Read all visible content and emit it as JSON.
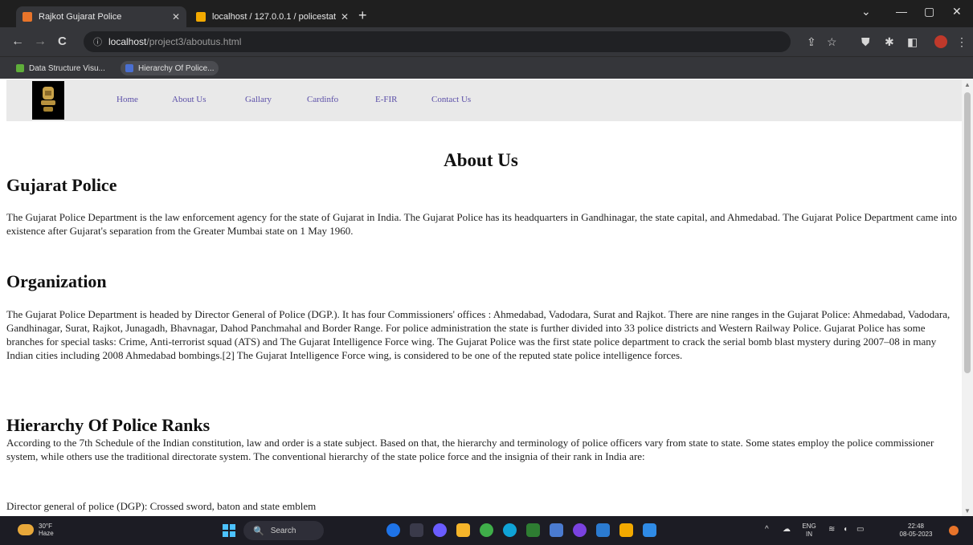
{
  "browser": {
    "tabs": [
      {
        "title": "Rajkot Gujarat Police",
        "active": true,
        "favicon_color": "#e8742a"
      },
      {
        "title": "localhost / 127.0.0.1 / policestat",
        "active": false,
        "favicon_color": "#f2a900"
      }
    ],
    "new_tab_glyph": "+",
    "window_controls": {
      "tab_list": "⌄",
      "minimize": "—",
      "maximize": "▢",
      "close": "✕"
    },
    "nav": {
      "back": "←",
      "forward": "→",
      "reload": "C"
    },
    "address": {
      "host": "localhost",
      "path": "/project3/aboutus.html"
    },
    "bookmarks": [
      {
        "label": "Data Structure Visu...",
        "icon_color": "#5fae3a"
      },
      {
        "label": "Hierarchy Of Police...",
        "icon_color": "#4a6fd1"
      }
    ]
  },
  "site": {
    "nav_links": [
      "Home",
      "About Us",
      "Gallary",
      "Cardinfo",
      "E-FIR",
      "Contact Us"
    ],
    "page_title": "About Us",
    "sections": [
      {
        "heading": "Gujarat Police",
        "paragraphs": [
          "The Gujarat Police Department is the law enforcement agency for the state of Gujarat in India. The Gujarat Police has its headquarters in Gandhinagar, the state capital, and Ahmedabad. The Gujarat Police Department came into existence after Gujarat's separation from the Greater Mumbai state on 1 May 1960."
        ]
      },
      {
        "heading": "Organization",
        "paragraphs": [
          "The Gujarat Police Department is headed by Director General of Police (DGP.). It has four Commissioners' offices : Ahmedabad, Vadodara, Surat and Rajkot. There are nine ranges in the Gujarat Police: Ahmedabad, Vadodara, Gandhinagar, Surat, Rajkot, Junagadh, Bhavnagar, Dahod Panchmahal and Border Range. For police administration the state is further divided into 33 police districts and Western Railway Police. Gujarat Police has some branches for special tasks: Crime, Anti-terrorist squad (ATS) and The Gujarat Intelligence Force wing. The Gujarat Police was the first state police department to crack the serial bomb blast mystery during 2007–08 in many Indian cities including 2008 Ahmedabad bombings.[2] The Gujarat Intelligence Force wing, is considered to be one of the reputed state police intelligence forces."
        ]
      },
      {
        "heading": "Hierarchy Of Police Ranks",
        "paragraphs": [
          "According to the 7th Schedule of the Indian constitution, law and order is a state subject. Based on that, the hierarchy and terminology of police officers vary from state to state. Some states employ the police commissioner system, while others use the traditional directorate system. The conventional hierarchy of the state police force and the insignia of their rank in India are:",
          "Director general of police (DGP): Crossed sword, baton and state emblem"
        ]
      }
    ]
  },
  "taskbar": {
    "weather": {
      "temp": "30°F",
      "condition": "Haze"
    },
    "search_label": "Search",
    "search_icon": "🔍",
    "tray_chevron": "^",
    "language": {
      "line1": "ENG",
      "line2": "IN"
    },
    "clock": {
      "time": "22:48",
      "date": "08-05-2023"
    },
    "app_colors": [
      "#1e73e8",
      "#3a3a4a",
      "#6a5cff",
      "#f5b52a",
      "#3fae49",
      "#0fa3d6",
      "#2e7d32",
      "#4a7bd0",
      "#7a42e0",
      "#2b7bd1",
      "#f2a900",
      "#2f8be6"
    ]
  }
}
